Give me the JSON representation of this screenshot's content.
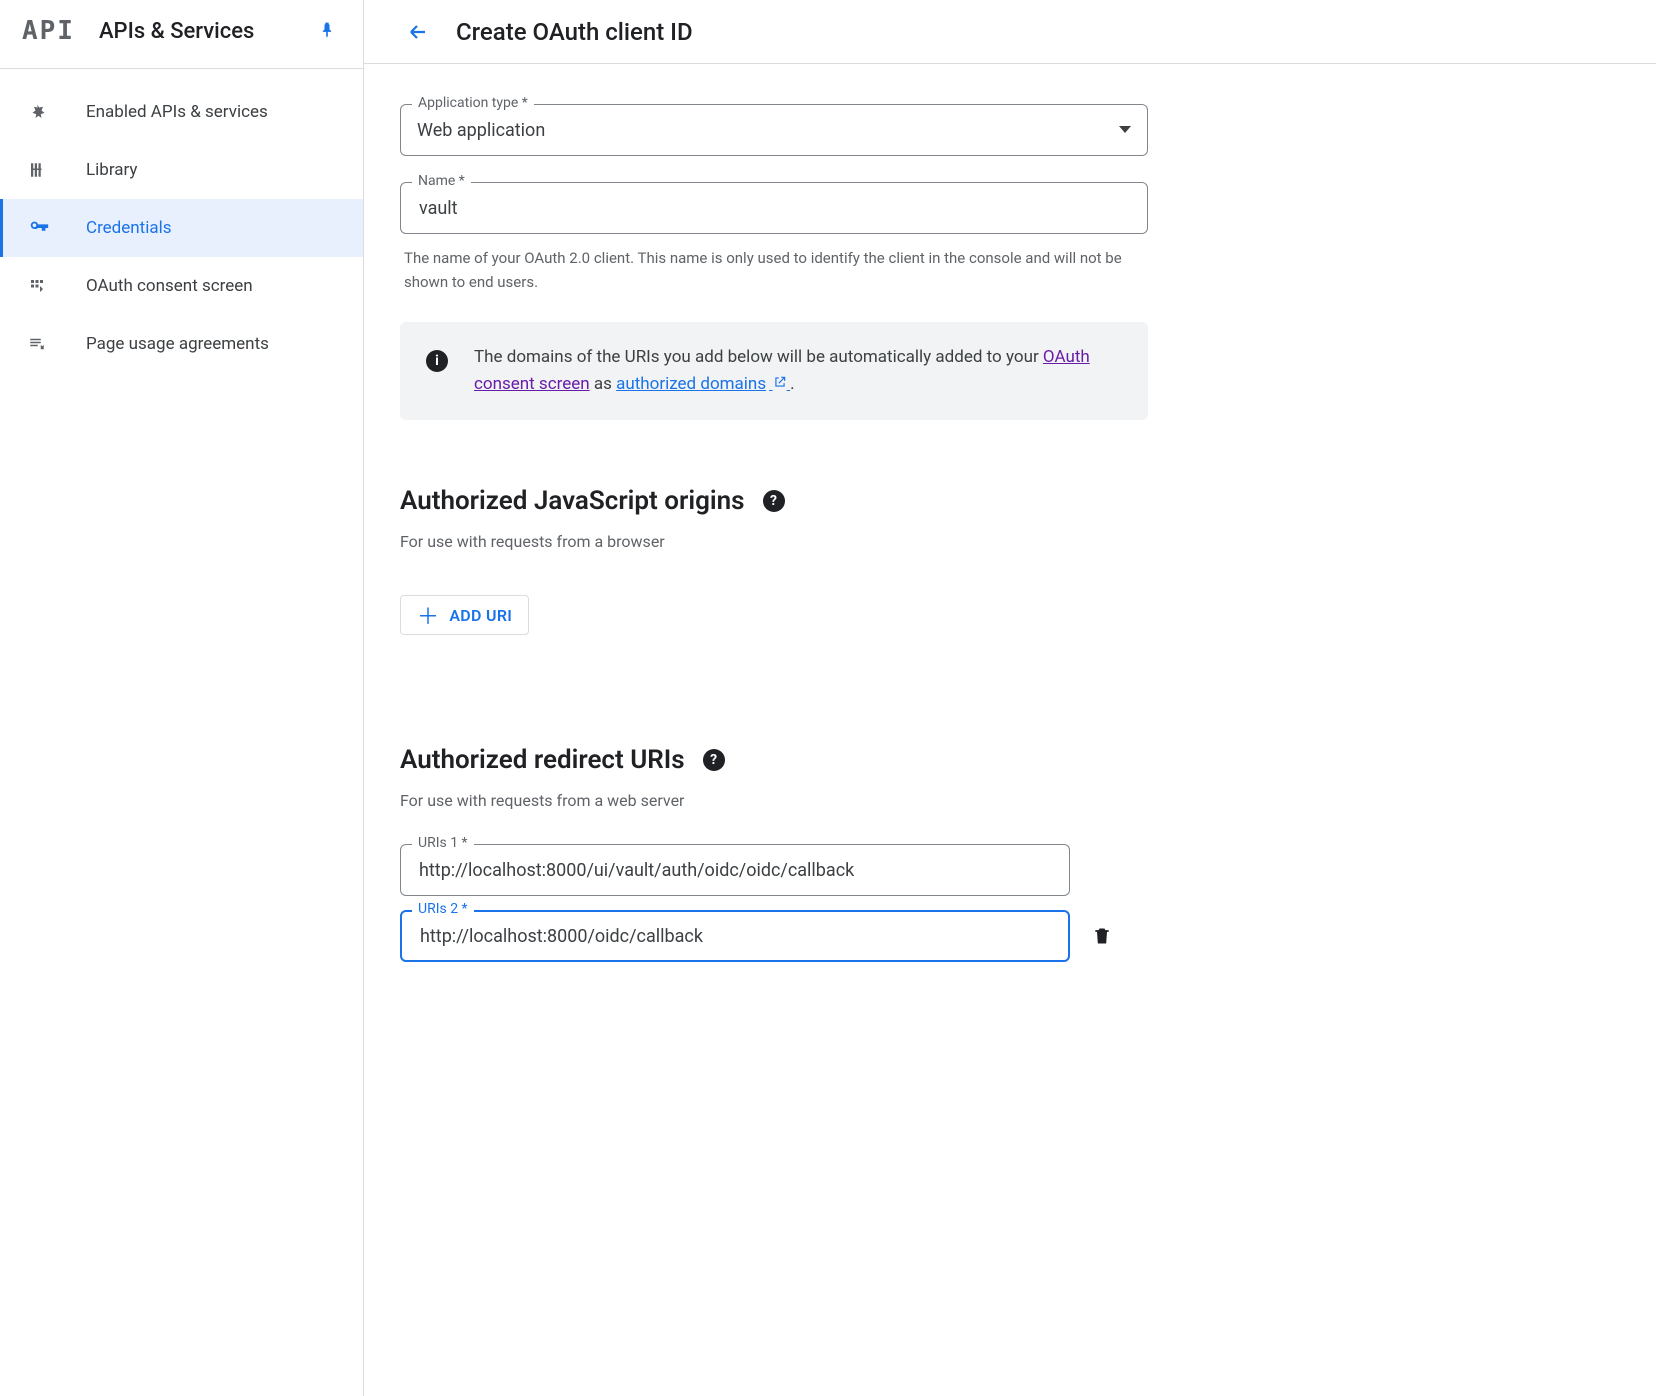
{
  "app": {
    "api_mark": "API",
    "sidebar_title": "APIs & Services"
  },
  "sidebar": {
    "items": [
      {
        "label": "Enabled APIs & services",
        "icon": "enabled-apis-icon",
        "active": false
      },
      {
        "label": "Library",
        "icon": "library-icon",
        "active": false
      },
      {
        "label": "Credentials",
        "icon": "key-icon",
        "active": true
      },
      {
        "label": "OAuth consent screen",
        "icon": "consent-icon",
        "active": false
      },
      {
        "label": "Page usage agreements",
        "icon": "agreements-icon",
        "active": false
      }
    ]
  },
  "header": {
    "page_title": "Create OAuth client ID"
  },
  "form": {
    "app_type_label": "Application type *",
    "app_type_value": "Web application",
    "name_label": "Name *",
    "name_value": "vault",
    "name_helper": "The name of your OAuth 2.0 client. This name is only used to identify the client in the console and will not be shown to end users."
  },
  "info": {
    "text_before": "The domains of the URIs you add below will be automatically added to your ",
    "link1": "OAuth consent screen",
    "text_mid": " as ",
    "link2": "authorized domains",
    "text_after": "."
  },
  "js_origins": {
    "title": "Authorized JavaScript origins",
    "subtitle": "For use with requests from a browser",
    "add_label": "ADD URI"
  },
  "redirect": {
    "title": "Authorized redirect URIs",
    "subtitle": "For use with requests from a web server",
    "uris": [
      {
        "label": "URIs 1 *",
        "value": "http://localhost:8000/ui/vault/auth/oidc/oidc/callback",
        "focused": false
      },
      {
        "label": "URIs 2 *",
        "value": "http://localhost:8000/oidc/callback",
        "focused": true
      }
    ]
  }
}
